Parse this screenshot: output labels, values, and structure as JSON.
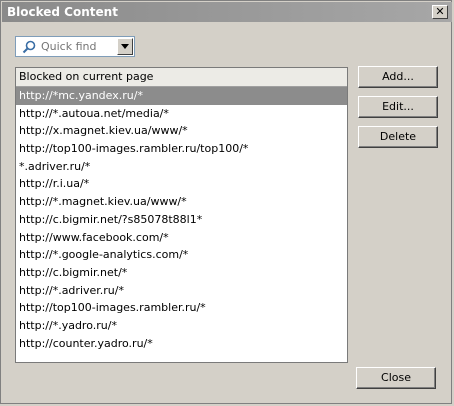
{
  "window": {
    "title": "Blocked Content",
    "close_glyph": "✕"
  },
  "quick_find": {
    "placeholder": "Quick find",
    "search_icon": "search-icon",
    "dropdown_icon": "chevron-down-icon"
  },
  "list": {
    "header": "Blocked on current page",
    "selected_index": 0,
    "items": [
      "http://*mc.yandex.ru/*",
      "http://*.autoua.net/media/*",
      "http://x.magnet.kiev.ua/www/*",
      "http://top100-images.rambler.ru/top100/*",
      "*.adriver.ru/*",
      "http://r.i.ua/*",
      "http://*.magnet.kiev.ua/www/*",
      "http://c.bigmir.net/?s85078t88l1*",
      "http://www.facebook.com/*",
      "http://*.google-analytics.com/*",
      "http://c.bigmir.net/*",
      "http://*.adriver.ru/*",
      "http://top100-images.rambler.ru/*",
      "http://*.yadro.ru/*",
      "http://counter.yadro.ru/*"
    ]
  },
  "buttons": {
    "add": "Add...",
    "edit": "Edit...",
    "delete": "Delete",
    "close": "Close"
  },
  "colors": {
    "selection": "#8c8c8c",
    "titlebar": "#8a8a8a",
    "face": "#d4d0c8"
  }
}
